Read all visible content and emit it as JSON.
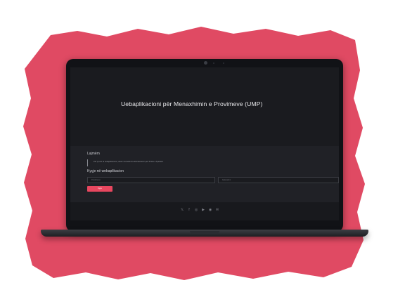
{
  "colors": {
    "background_blob": "#e04a63",
    "accent_button": "#e8475f",
    "screen_background": "#1c1d21"
  },
  "hero": {
    "title": "Uebaplikacioni për Menaxhimin e Provimeve (UMP)"
  },
  "section": {
    "heading": "Lajmëm",
    "notice_text": "Për ty keni të uebaplikacionin, duam menaxhimit administratorin për Smtës e Aparaten",
    "login_heading": "Kyçje në webaplikacion",
    "username_placeholder": "Perdoruesi",
    "password_placeholder": "Fjalekalimi",
    "login_button": "Kyçu"
  },
  "footer": {
    "social_icons": [
      "twitter-icon",
      "facebook-icon",
      "instagram-icon",
      "youtube-icon",
      "discord-icon",
      "email-icon"
    ]
  }
}
